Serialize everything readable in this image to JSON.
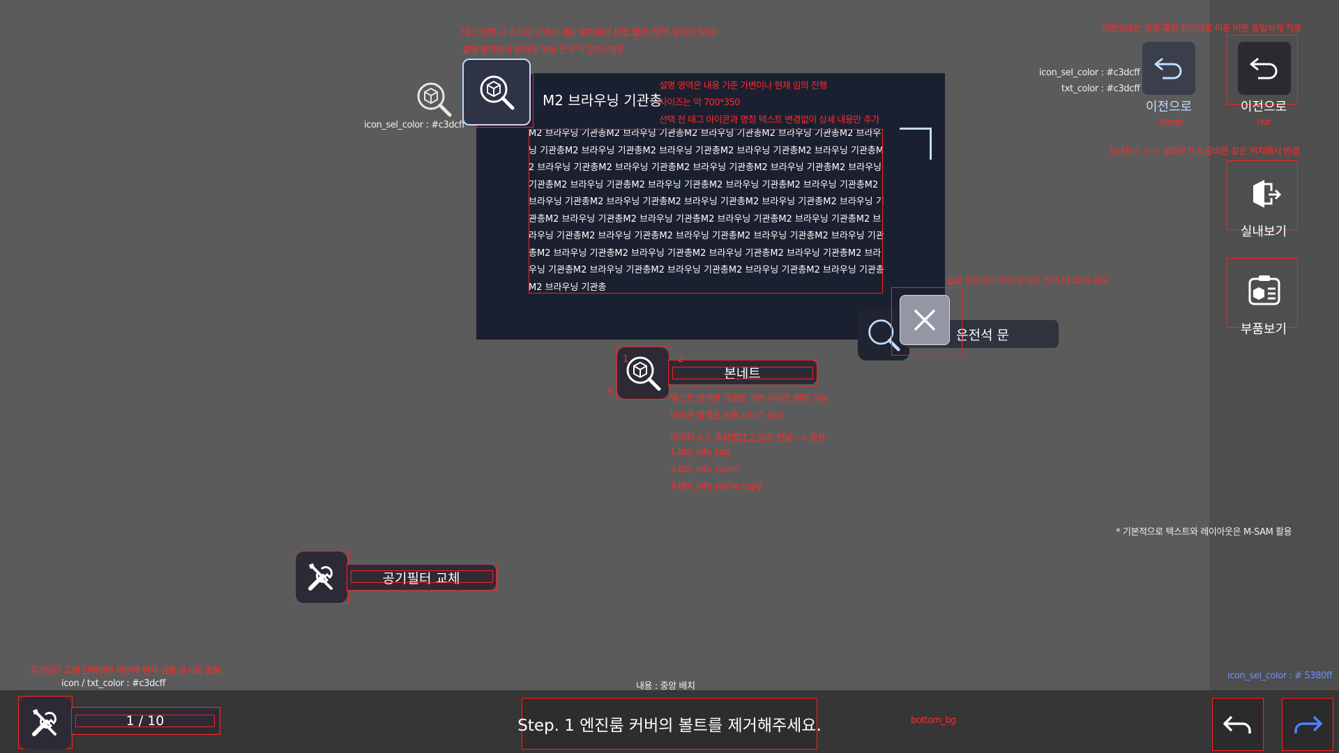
{
  "colors": {
    "icon_sel": "#c3dcff",
    "icon_sel_blue": "#5380ff",
    "annotation": "#ff2a2a",
    "popup_bg": "#1b2030",
    "bottom_bg": "#363636"
  },
  "annotations": {
    "top1": "태그 선택 시 스크린 안에서 해당 위치에서 팝업 열림 (영역 잘리지 않게)",
    "top2": "설명 영역에서 위아래 여유 간격 약 20% 정도",
    "icon_sel_left": "icon_sel_color : #c3dcff",
    "popup_note1": "설명 영역은 내용 기준 가변이나 현재 임의 진행",
    "popup_note2": "사이즈는 약 700*350",
    "popup_note3": "선택 전 태그 아이콘과 명칭 텍스트 변경없이 상세 내용만 추가",
    "close_note": "설명 영역에서 위아래 여유 간격 약 20% 정도",
    "tag_num1": "1",
    "tag_num2": "2",
    "tag_num3": "3",
    "tag_note1": "텍스트 영역만 가로로 가변 사이즈 변경 가능",
    "tag_note2": "아이콘 영역은 비율 사이즈 유지",
    "tag_note3": "이미지 소스 종류별(1,2,3)로 전달 --> 활용",
    "tag_src1": "1.btn_info_tag",
    "tag_src2": "2.btn_info_name",
    "tag_src3": "3.btn_info_name copy",
    "right_top": "이전으로는 상위 혹은 전단계로 이동 버튼 동일하게 적용",
    "right_color1": "icon_sel_color : #c3dcff",
    "right_color2": "txt_color : #c3dcff",
    "hover": "hover",
    "nor": "nor",
    "toggle_note": "실내보기 <-> 실외보기 토글버튼 같은 위치에서 변경",
    "msam_note": "* 기본적으로 텍스트와 레이아웃은 M-SAM 활용",
    "bottom_left1": "공기필터 교체 선택하면 하단에 현재 상황 표시로 활용",
    "bottom_left2": "icon / txt_color : #c3dcff",
    "center_note": "내용 : 중앙 배치",
    "bottom_bg_label": "bottom_bg",
    "icon_sel_blue_label": "icon_sel_color : # 5380ff"
  },
  "popup": {
    "title": "M2 브라우닝 기관총",
    "description": "M2 브라우닝 기관총M2 브라우닝 기관총M2 브라우닝 기관총M2 브라우닝 기관총M2 브라우닝 기관총M2 브라우닝 기관총M2 브라우닝 기관총M2 브라우닝 기관총M2 브라우닝 기관총M2 브라우닝 기관총M2 브라우닝 기관총M2 브라우닝 기관총M2 브라우닝 기관총M2 브라우닝 기관총M2 브라우닝 기관총M2 브라우닝 기관총M2 브라우닝 기관총M2 브라우닝 기관총M2 브라우닝 기관총M2 브라우닝 기관총M2 브라우닝 기관총M2 브라우닝 기관총M2 브라우닝 기관총M2 브라우닝 기관총M2 브라우닝 기관총M2 브라우닝 기관총M2 브라우닝 기관총M2 브라우닝 기관총M2 브라우닝 기관총M2 브라우닝 기관총M2 브라우닝 기관총M2 브라우닝 기관총M2 브라우닝 기관총M2 브라우닝 기관총M2 브라우닝 기관총M2 브라우닝 기관총M2 브라우닝 기관총M2 브라우닝 기관총M2 브라우닝 기관총M2 브라우닝 기관총M2 브라우닝 기관총M2 브라우닝 기관총"
  },
  "tags": {
    "driver_seat": "운전석 문",
    "bonnet": "본네트",
    "air_filter": "공기필터 교체"
  },
  "sidebar": {
    "back_hover_label": "이전으로",
    "back_normal_label": "이전으로",
    "interior_label": "실내보기",
    "parts_label": "부품보기"
  },
  "bottom": {
    "progress": "1 / 10",
    "step_text": "Step. 1 엔진룸 커버의 볼트를 제거해주세요."
  }
}
